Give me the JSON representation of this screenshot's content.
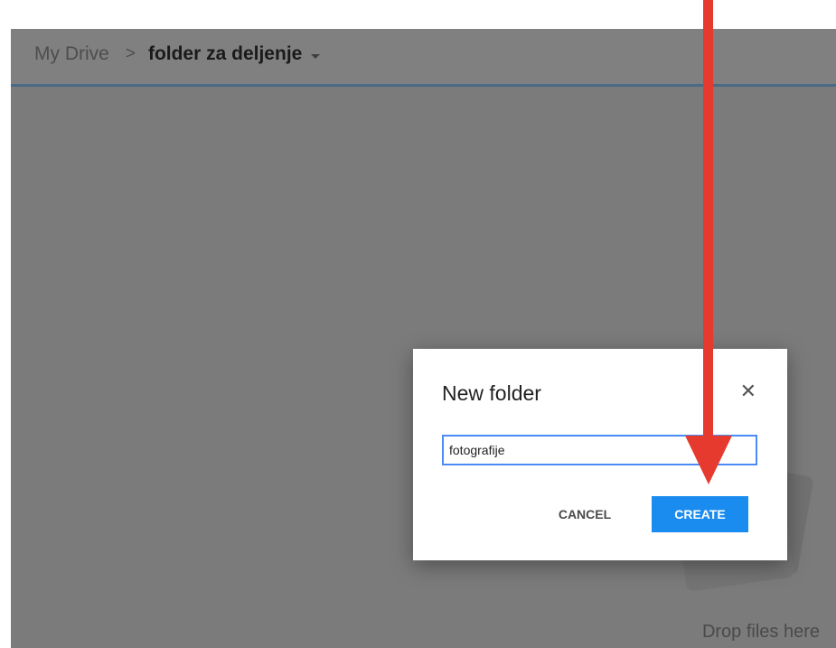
{
  "breadcrumb": {
    "root": "My Drive",
    "separator": ">",
    "current": "folder za deljenje"
  },
  "drop_zone": {
    "label": "Drop files here"
  },
  "dialog": {
    "title": "New folder",
    "close_icon": "close-icon",
    "input_value": "fotografije",
    "cancel_label": "CANCEL",
    "create_label": "CREATE"
  },
  "colors": {
    "accent": "#1a8cf0",
    "annotation_arrow": "#e53a2d",
    "overlay": "#7b7b7b"
  }
}
